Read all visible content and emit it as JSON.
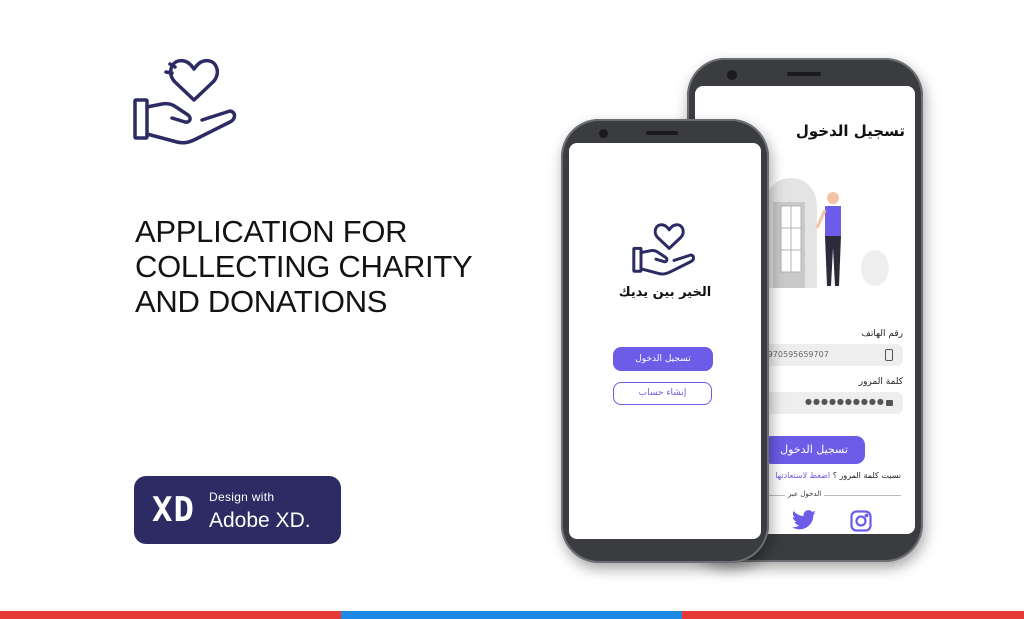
{
  "headline": {
    "line1": "APPLICATION FOR",
    "line2": "COLLECTING CHARITY",
    "line3": "AND DONATIONS"
  },
  "badge": {
    "mark": "XD",
    "small": "Design with",
    "big": "Adobe XD."
  },
  "splash": {
    "app_name": "الخير بين يديك",
    "login_button": "تسجيل الدخول",
    "signup_button": "إنشاء حساب"
  },
  "login": {
    "title": "تسجيل الدخول",
    "phone_label": "رقم الهاتف",
    "phone_value": "+970595659707",
    "password_label": "كلمة المرور",
    "password_value": "●●●●●●●●●●",
    "submit_button": "تسجيل الدخول",
    "forgot_text": "نسيت كلمة المرور ؟",
    "forgot_link": "اضغط لاستعادتها",
    "social_label": "الدخول عبر"
  },
  "colors": {
    "accent": "#6c5ce7",
    "badge_bg": "#2d2b63",
    "stripe_red": "#e53935",
    "stripe_blue": "#1e88e5"
  },
  "icons": [
    "charity-hand-heart-icon",
    "phone-icon",
    "lock-icon",
    "twitter-icon",
    "instagram-icon"
  ]
}
